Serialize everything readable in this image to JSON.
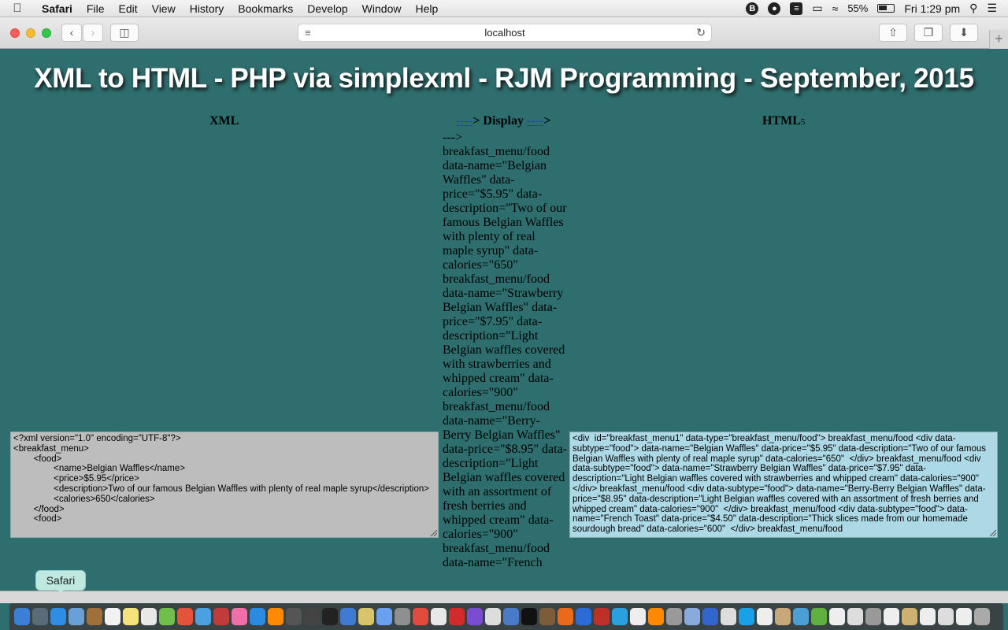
{
  "menubar": {
    "app": "Safari",
    "items": [
      "File",
      "Edit",
      "View",
      "History",
      "Bookmarks",
      "Develop",
      "Window",
      "Help"
    ],
    "battery": "55%",
    "clock": "Fri 1:29 pm"
  },
  "toolbar": {
    "url": "localhost"
  },
  "page": {
    "title": "XML to HTML - PHP via simplexml - RJM Programming - September, 2015",
    "col_xml": "XML",
    "col_display_arrow_left": "----",
    "col_display_mid": "> Display ",
    "col_display_arrow_right": "----",
    "col_display_end": ">",
    "col_html": "HTML",
    "col_html_suffix": "5",
    "xml_content": "<?xml version=\"1.0\" encoding=\"UTF-8\"?>\n<breakfast_menu>\n        <food>\n                <name>Belgian Waffles</name>\n                <price>$5.95</price>\n                <description>Two of our famous Belgian Waffles with plenty of real maple syrup</description>\n                <calories>650</calories>\n        </food>\n        <food>",
    "display_text": "---> breakfast_menu/food data-name=\"Belgian Waffles\" data-price=\"$5.95\" data-description=\"Two of our famous Belgian Waffles with plenty of real maple syrup\" data-calories=\"650\" breakfast_menu/food data-name=\"Strawberry Belgian Waffles\" data-price=\"$7.95\" data-description=\"Light Belgian waffles covered with strawberries and whipped cream\" data-calories=\"900\" breakfast_menu/food data-name=\"Berry-Berry Belgian Waffles\" data-price=\"$8.95\" data-description=\"Light Belgian waffles covered with an assortment of fresh berries and whipped cream\" data-calories=\"900\" breakfast_menu/food data-name=\"French",
    "html_content": "<div  id=\"breakfast_menu1\" data-type=\"breakfast_menu/food\"> breakfast_menu/food <div data-subtype=\"food\"> data-name=\"Belgian Waffles\" data-price=\"$5.95\" data-description=\"Two of our famous Belgian Waffles with plenty of real maple syrup\" data-calories=\"650\"  </div> breakfast_menu/food <div data-subtype=\"food\"> data-name=\"Strawberry Belgian Waffles\" data-price=\"$7.95\" data-description=\"Light Belgian waffles covered with strawberries and whipped cream\" data-calories=\"900\"  </div> breakfast_menu/food <div data-subtype=\"food\"> data-name=\"Berry-Berry Belgian Waffles\" data-price=\"$8.95\" data-description=\"Light Belgian waffles covered with an assortment of fresh berries and whipped cream\" data-calories=\"900\"  </div> breakfast_menu/food <div data-subtype=\"food\"> data-name=\"French Toast\" data-price=\"$4.50\" data-description=\"Thick slices made from our homemade sourdough bread\" data-calories=\"600\"  </div> breakfast_menu/food"
  },
  "dock": {
    "tooltip": "Safari",
    "icon_colors": [
      "#3b7fd8",
      "#5a6c7a",
      "#2f8de4",
      "#6aa0d8",
      "#a0703a",
      "#f2f2f2",
      "#f5e27a",
      "#e8e8e8",
      "#6fbf4a",
      "#e6533c",
      "#4aa0e0",
      "#c23b3b",
      "#f06fa8",
      "#2b8be0",
      "#ff8a00",
      "#555",
      "#444",
      "#222",
      "#3f7bd3",
      "#d9c36b",
      "#6aa0f0",
      "#8f8f8f",
      "#e24b3b",
      "#e8e8e8",
      "#d32a2a",
      "#7a4cd1",
      "#ddd",
      "#4a7bc9",
      "#111",
      "#7d5c3a",
      "#e86a1a",
      "#2a6bd6",
      "#c0302a",
      "#2aa0e0",
      "#eee",
      "#ff8800",
      "#999",
      "#88aadd",
      "#3366cc",
      "#ddd",
      "#1aa0e8",
      "#eee",
      "#c8a878",
      "#4a9fd5",
      "#60b040",
      "#eee",
      "#ddd",
      "#999",
      "#eee",
      "#d0b070",
      "#eee",
      "#ddd",
      "#eee",
      "#aaa"
    ]
  }
}
